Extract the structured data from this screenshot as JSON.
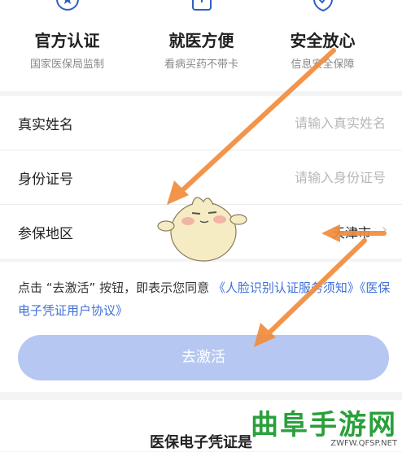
{
  "features": [
    {
      "title": "官方认证",
      "subtitle": "国家医保局监制",
      "icon": "star-badge-icon"
    },
    {
      "title": "就医方便",
      "subtitle": "看病买药不带卡",
      "icon": "card-icon"
    },
    {
      "title": "安全放心",
      "subtitle": "信息安全保障",
      "icon": "shield-icon"
    }
  ],
  "form": {
    "name_label": "真实姓名",
    "name_placeholder": "请输入真实姓名",
    "id_label": "身份证号",
    "id_placeholder": "请输入身份证号",
    "region_label": "参保地区",
    "region_value": "天津市"
  },
  "agreement": {
    "prefix": "点击 “去激活” 按钮，即表示您同意 ",
    "link1": "《人脸识别认证服务须知》",
    "link2": "《医保电子凭证用户协议》"
  },
  "button_label": "去激活",
  "bottom_title": "医保电子凭证是",
  "watermark": {
    "main": "曲阜手游网",
    "url": "ZWFW.QFSP.NET"
  },
  "colors": {
    "accent": "#3f6fd8",
    "button": "#b6c8f2",
    "arrow": "#f28c3c"
  }
}
